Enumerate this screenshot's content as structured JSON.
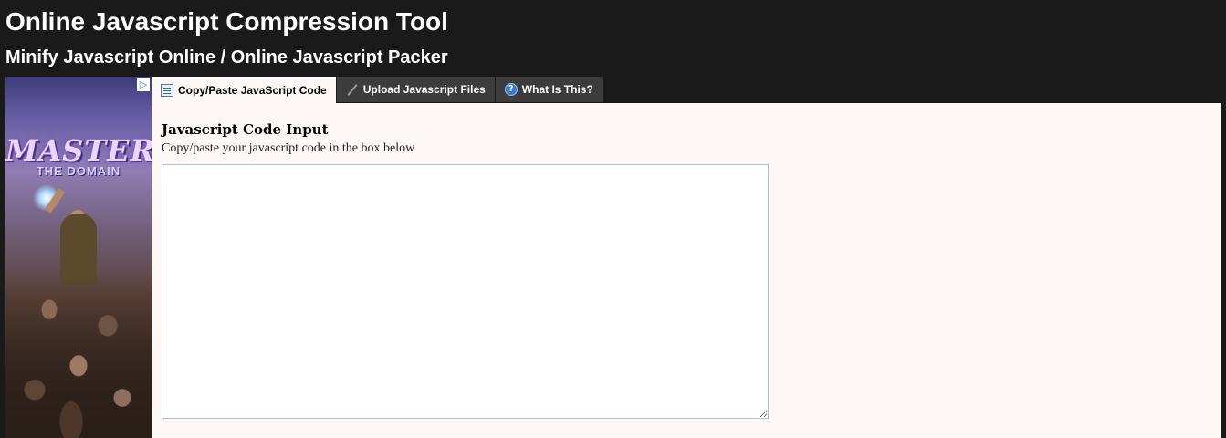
{
  "header": {
    "title": "Online Javascript Compression Tool",
    "subtitle": "Minify Javascript Online / Online Javascript Packer"
  },
  "ad": {
    "logo_line1": "MASTER",
    "logo_line2": "THE DOMAIN",
    "privacy_icon": "adchoices-icon"
  },
  "tabs": [
    {
      "label": "Copy/Paste JavaScript Code",
      "icon": "code-document-icon",
      "active": true
    },
    {
      "label": "Upload Javascript Files",
      "icon": "pencil-icon",
      "active": false
    },
    {
      "label": "What Is This?",
      "icon": "help-icon",
      "active": false
    }
  ],
  "main": {
    "section_title": "Javascript Code Input",
    "section_desc": "Copy/paste your javascript code in the box below",
    "code_input_value": "",
    "code_input_placeholder": ""
  },
  "colors": {
    "page_background": "#1a1a1a",
    "panel_background": "#fdf8f6",
    "tab_inactive": "#3c3c3c",
    "input_border": "#a9c2d8"
  }
}
